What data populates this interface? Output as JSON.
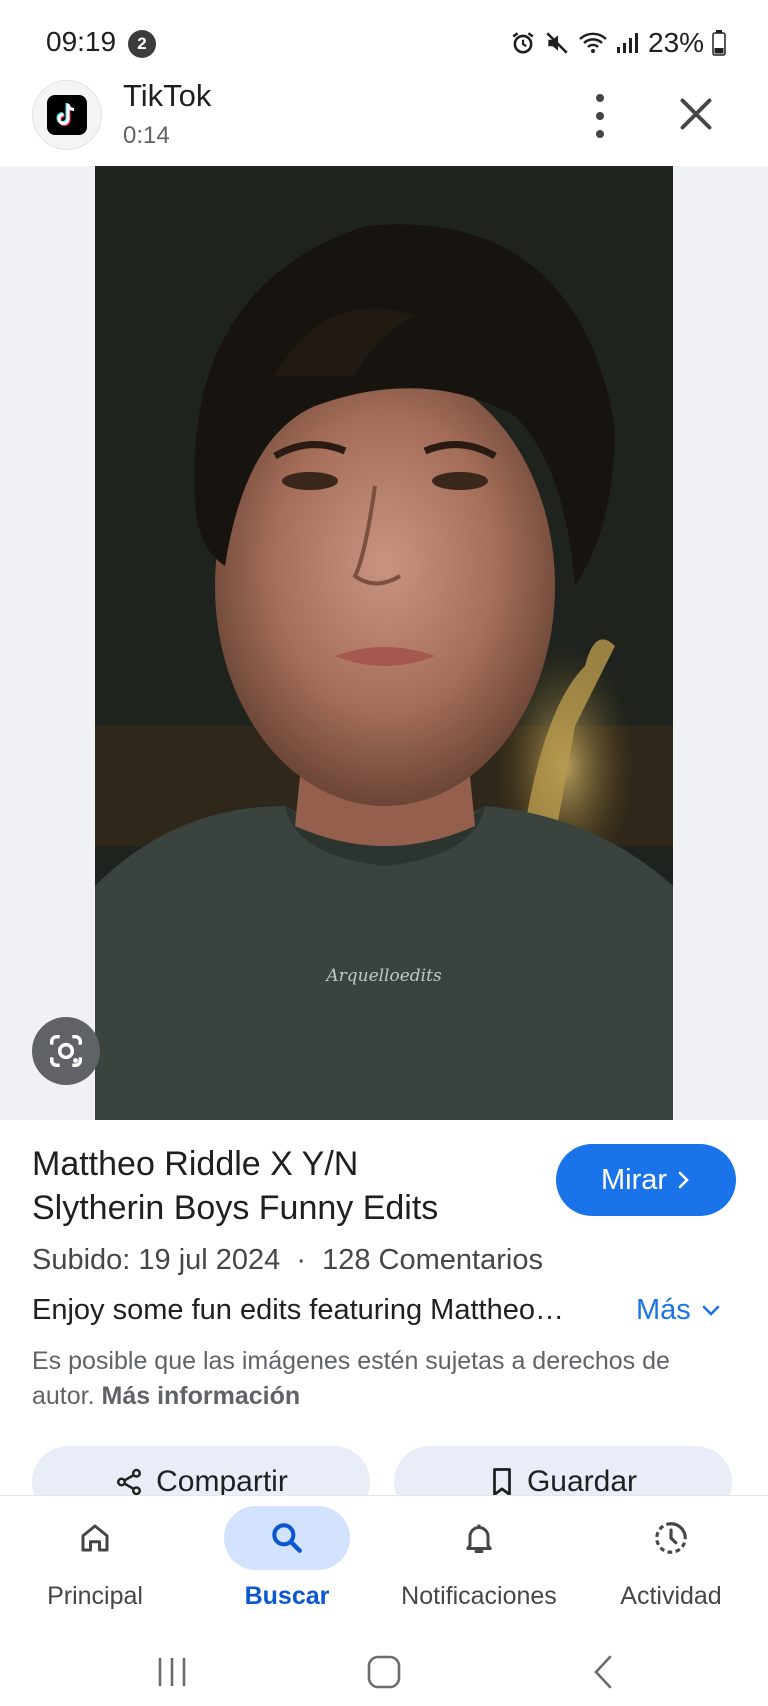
{
  "status_bar": {
    "time": "09:19",
    "notification_count": "2",
    "battery": "23%"
  },
  "header": {
    "app_name": "TikTok",
    "duration": "0:14"
  },
  "media": {
    "watermark": "Arquelloedits"
  },
  "info": {
    "title_line1": "Mattheo Riddle X Y/N",
    "title_line2": "Slytherin Boys Funny Edits",
    "watch_label": "Mirar",
    "uploaded": "Subido: 19 jul 2024",
    "separator": "·",
    "comments": "128 Comentarios",
    "description": "Enjoy some fun edits featuring Mattheo…",
    "more_label": "Más",
    "copyright_text": "Es posible que las imágenes estén sujetas a derechos de autor.",
    "learn_more": "Más información"
  },
  "actions": {
    "share_label": "Compartir",
    "save_label": "Guardar"
  },
  "bottom_nav": {
    "items": [
      {
        "label": "Principal",
        "icon": "home-icon"
      },
      {
        "label": "Buscar",
        "icon": "search-icon",
        "active": true
      },
      {
        "label": "Notificaciones",
        "icon": "bell-icon"
      },
      {
        "label": "Actividad",
        "icon": "activity-icon"
      }
    ]
  },
  "colors": {
    "accent": "#1a73e8",
    "active_nav_bg": "#d3e3fd",
    "action_bg": "#e8edf8"
  }
}
